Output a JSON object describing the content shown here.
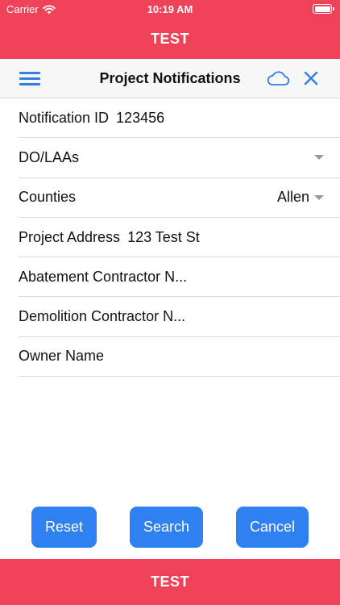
{
  "status_bar": {
    "carrier": "Carrier",
    "time": "10:19 AM"
  },
  "banner": {
    "top_text": "TEST",
    "bottom_text": "TEST",
    "color": "#ee4259"
  },
  "nav": {
    "title": "Project Notifications",
    "menu_icon": "hamburger-menu-icon",
    "cloud_icon": "cloud-icon",
    "close_icon": "close-icon",
    "accent": "#2f7fe5"
  },
  "form": {
    "notification_id": {
      "label": "Notification ID",
      "value": "123456"
    },
    "do_laas": {
      "label": "DO/LAAs",
      "value": ""
    },
    "counties": {
      "label": "Counties",
      "value": "Allen"
    },
    "project_address": {
      "label": "Project Address",
      "value": "123 Test St"
    },
    "abatement_contractor": {
      "label": "Abatement Contractor N..."
    },
    "demolition_contractor": {
      "label": "Demolition Contractor N..."
    },
    "owner_name": {
      "label": "Owner Name"
    }
  },
  "buttons": {
    "reset": "Reset",
    "search": "Search",
    "cancel": "Cancel",
    "color": "#2f80f0"
  }
}
